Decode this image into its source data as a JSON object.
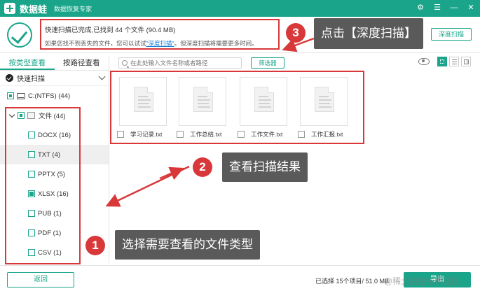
{
  "titlebar": {
    "app_name": "数据蛙",
    "subtitle": "数据恢复专家",
    "buttons": [
      "⚙",
      "☰",
      "—",
      "✕"
    ]
  },
  "status": {
    "line1": "快速扫描已完成,已找到 44 个文件 (90.4 MB)",
    "line2_prefix": "如果您找不到丢失的文件，您可以试试",
    "line2_link": "\"深度扫描\"",
    "line2_suffix": "。但深度扫描将需要更多时间。",
    "deep_scan_button": "深度扫描"
  },
  "tabs": [
    "按类型查看",
    "按路径查看"
  ],
  "scan_mode": "快速扫描",
  "tree": {
    "drive": "C:(NTFS) (44)",
    "folder": "文件 (44)",
    "types": [
      {
        "label": "DOCX (16)",
        "state": "empty"
      },
      {
        "label": "TXT (4)",
        "state": "empty",
        "selected": true
      },
      {
        "label": "PPTX (5)",
        "state": "empty"
      },
      {
        "label": "XLSX (16)",
        "state": "full"
      },
      {
        "label": "PUB (1)",
        "state": "empty"
      },
      {
        "label": "PDF (1)",
        "state": "empty"
      },
      {
        "label": "CSV (1)",
        "state": "empty"
      }
    ]
  },
  "toolbar": {
    "search_placeholder": "在此处输入文件名称或者路径",
    "filter_button": "筛选器"
  },
  "files": [
    "学习记录.txt",
    "工作总结.txt",
    "工作文件.txt",
    "工作汇报.txt"
  ],
  "callouts": [
    {
      "num": "3",
      "text": "点击【深度扫描】"
    },
    {
      "num": "2",
      "text": "查看扫描结果"
    },
    {
      "num": "1",
      "text": "选择需要查看的文件类型"
    }
  ],
  "bottom": {
    "back_button": "返回",
    "selected_info": "已选择 15个项目/ 51.0 MB",
    "export_button": "导出"
  },
  "watermark": "@稀土掘金技术社区",
  "colors": {
    "accent": "#1aa58a",
    "annotation_red": "#d8383a",
    "callout_bg": "#5a5a5a"
  }
}
